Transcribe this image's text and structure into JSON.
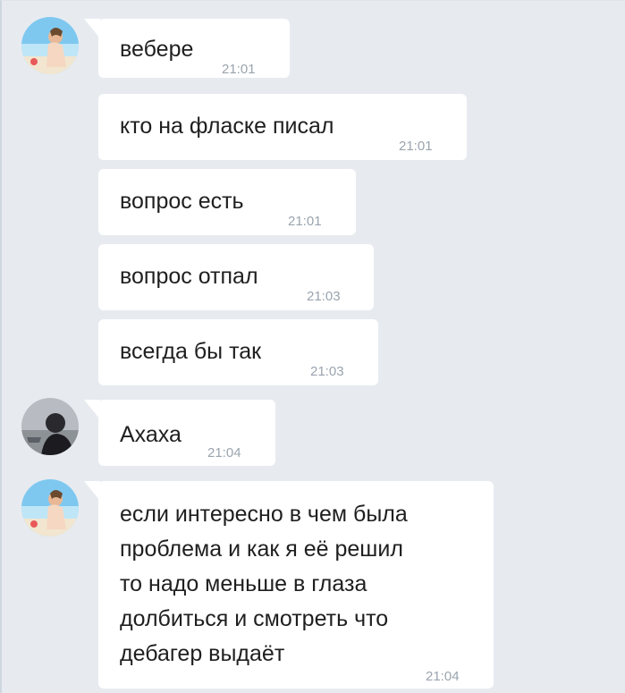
{
  "messages": [
    {
      "text": "вебере",
      "time": "21:01"
    },
    {
      "text": "кто на фласке писал",
      "time": "21:01"
    },
    {
      "text": "вопрос есть",
      "time": "21:01"
    },
    {
      "text": "вопрос отпал",
      "time": "21:03"
    },
    {
      "text": "всегда бы так",
      "time": "21:03"
    },
    {
      "text": "Ахаха",
      "time": "21:04"
    },
    {
      "lines": [
        "если интересно в чем была",
        "проблема и как я её решил",
        "то надо меньше в глаза",
        "долбиться и смотреть что",
        "дебагер выдаёт"
      ],
      "time": "21:04"
    }
  ],
  "colors": {
    "background": "#e7ebf0",
    "bubble": "#ffffff",
    "time": "#9aa4ae"
  }
}
